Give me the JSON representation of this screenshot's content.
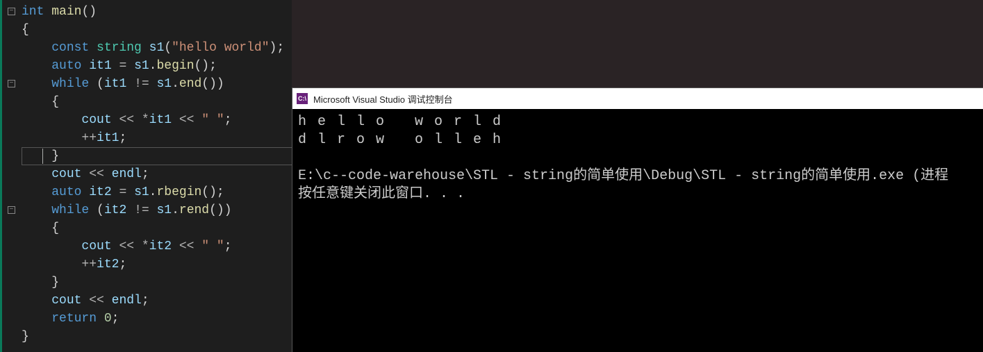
{
  "editor": {
    "code_lines": [
      {
        "tokens": [
          {
            "t": "int ",
            "c": "kw"
          },
          {
            "t": "main",
            "c": "func"
          },
          {
            "t": "()",
            "c": "punc"
          }
        ]
      },
      {
        "tokens": [
          {
            "t": "{",
            "c": "punc"
          }
        ]
      },
      {
        "tokens": [
          {
            "t": "    ",
            "c": ""
          },
          {
            "t": "const ",
            "c": "kw"
          },
          {
            "t": "string ",
            "c": "typename"
          },
          {
            "t": "s1",
            "c": "id"
          },
          {
            "t": "(",
            "c": "punc"
          },
          {
            "t": "\"hello world\"",
            "c": "str"
          },
          {
            "t": ");",
            "c": "punc"
          }
        ]
      },
      {
        "tokens": [
          {
            "t": "    ",
            "c": ""
          },
          {
            "t": "auto ",
            "c": "kw"
          },
          {
            "t": "it1 ",
            "c": "id"
          },
          {
            "t": "= ",
            "c": "op"
          },
          {
            "t": "s1",
            "c": "id"
          },
          {
            "t": ".",
            "c": "punc"
          },
          {
            "t": "begin",
            "c": "func"
          },
          {
            "t": "();",
            "c": "punc"
          }
        ]
      },
      {
        "tokens": [
          {
            "t": "    ",
            "c": ""
          },
          {
            "t": "while ",
            "c": "kw"
          },
          {
            "t": "(",
            "c": "punc"
          },
          {
            "t": "it1 ",
            "c": "id"
          },
          {
            "t": "!= ",
            "c": "op"
          },
          {
            "t": "s1",
            "c": "id"
          },
          {
            "t": ".",
            "c": "punc"
          },
          {
            "t": "end",
            "c": "func"
          },
          {
            "t": "())",
            "c": "punc"
          }
        ]
      },
      {
        "tokens": [
          {
            "t": "    {",
            "c": "punc"
          }
        ]
      },
      {
        "tokens": [
          {
            "t": "        ",
            "c": ""
          },
          {
            "t": "cout ",
            "c": "id"
          },
          {
            "t": "<< ",
            "c": "op"
          },
          {
            "t": "*",
            "c": "op"
          },
          {
            "t": "it1 ",
            "c": "id"
          },
          {
            "t": "<< ",
            "c": "op"
          },
          {
            "t": "\" \"",
            "c": "str"
          },
          {
            "t": ";",
            "c": "punc"
          }
        ]
      },
      {
        "tokens": [
          {
            "t": "        ",
            "c": ""
          },
          {
            "t": "++",
            "c": "op"
          },
          {
            "t": "it1",
            "c": "id"
          },
          {
            "t": ";",
            "c": "punc"
          }
        ]
      },
      {
        "tokens": [
          {
            "t": "    }",
            "c": "punc"
          }
        ]
      },
      {
        "tokens": [
          {
            "t": "    ",
            "c": ""
          },
          {
            "t": "cout ",
            "c": "id"
          },
          {
            "t": "<< ",
            "c": "op"
          },
          {
            "t": "endl",
            "c": "id"
          },
          {
            "t": ";",
            "c": "punc"
          }
        ]
      },
      {
        "tokens": [
          {
            "t": "    ",
            "c": ""
          },
          {
            "t": "auto ",
            "c": "kw"
          },
          {
            "t": "it2 ",
            "c": "id"
          },
          {
            "t": "= ",
            "c": "op"
          },
          {
            "t": "s1",
            "c": "id"
          },
          {
            "t": ".",
            "c": "punc"
          },
          {
            "t": "rbegin",
            "c": "func"
          },
          {
            "t": "();",
            "c": "punc"
          }
        ]
      },
      {
        "tokens": [
          {
            "t": "    ",
            "c": ""
          },
          {
            "t": "while ",
            "c": "kw"
          },
          {
            "t": "(",
            "c": "punc"
          },
          {
            "t": "it2 ",
            "c": "id"
          },
          {
            "t": "!= ",
            "c": "op"
          },
          {
            "t": "s1",
            "c": "id"
          },
          {
            "t": ".",
            "c": "punc"
          },
          {
            "t": "rend",
            "c": "func"
          },
          {
            "t": "())",
            "c": "punc"
          }
        ]
      },
      {
        "tokens": [
          {
            "t": "    {",
            "c": "punc"
          }
        ]
      },
      {
        "tokens": [
          {
            "t": "        ",
            "c": ""
          },
          {
            "t": "cout ",
            "c": "id"
          },
          {
            "t": "<< ",
            "c": "op"
          },
          {
            "t": "*",
            "c": "op"
          },
          {
            "t": "it2 ",
            "c": "id"
          },
          {
            "t": "<< ",
            "c": "op"
          },
          {
            "t": "\" \"",
            "c": "str"
          },
          {
            "t": ";",
            "c": "punc"
          }
        ]
      },
      {
        "tokens": [
          {
            "t": "        ",
            "c": ""
          },
          {
            "t": "++",
            "c": "op"
          },
          {
            "t": "it2",
            "c": "id"
          },
          {
            "t": ";",
            "c": "punc"
          }
        ]
      },
      {
        "tokens": [
          {
            "t": "    }",
            "c": "punc"
          }
        ]
      },
      {
        "tokens": [
          {
            "t": "    ",
            "c": ""
          },
          {
            "t": "cout ",
            "c": "id"
          },
          {
            "t": "<< ",
            "c": "op"
          },
          {
            "t": "endl",
            "c": "id"
          },
          {
            "t": ";",
            "c": "punc"
          }
        ]
      },
      {
        "tokens": [
          {
            "t": "    ",
            "c": ""
          },
          {
            "t": "return ",
            "c": "kw"
          },
          {
            "t": "0",
            "c": "num"
          },
          {
            "t": ";",
            "c": "punc"
          }
        ]
      },
      {
        "tokens": [
          {
            "t": "}",
            "c": "punc"
          }
        ]
      }
    ],
    "fold_markers": [
      {
        "line": 0,
        "symbol": "−"
      },
      {
        "line": 4,
        "symbol": "−"
      },
      {
        "line": 11,
        "symbol": "−"
      }
    ]
  },
  "console": {
    "icon_text": "C:\\",
    "title": "Microsoft Visual Studio 调试控制台",
    "output_lines": [
      "h e l l o   w o r l d",
      "d l r o w   o l l e h",
      "",
      "E:\\c--code-warehouse\\STL - string的简单使用\\Debug\\STL - string的简单使用.exe (进程",
      "按任意键关闭此窗口. . ."
    ]
  }
}
